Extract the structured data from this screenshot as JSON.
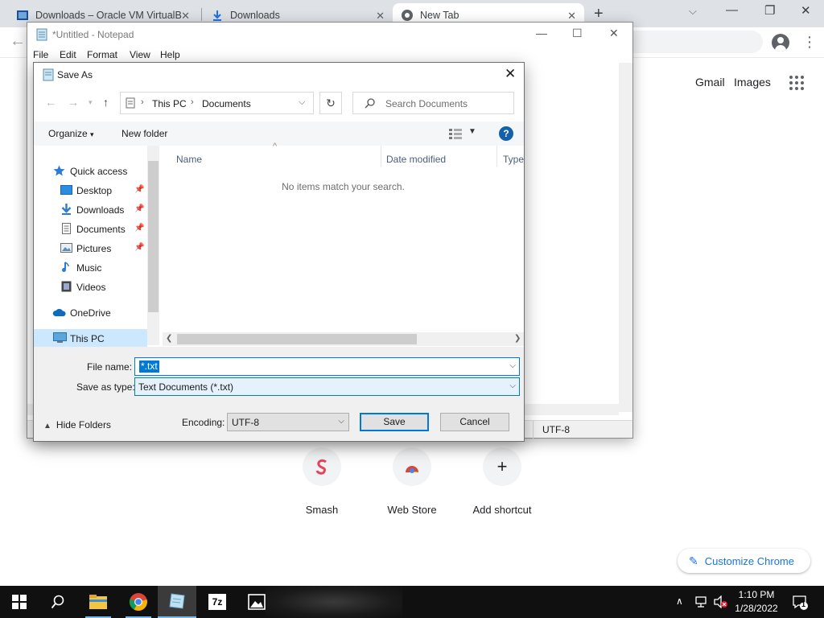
{
  "chrome": {
    "tabs": [
      {
        "label": "Downloads – Oracle VM VirtualB",
        "icon": "virtualbox-icon"
      },
      {
        "label": "Downloads",
        "icon": "download-icon"
      },
      {
        "label": "New Tab",
        "icon": "chrome-icon"
      }
    ],
    "header_links": {
      "gmail": "Gmail",
      "images": "Images"
    },
    "shortcuts": [
      {
        "label": "Smash",
        "icon": "smash-icon"
      },
      {
        "label": "Web Store",
        "icon": "webstore-icon"
      },
      {
        "label": "Add shortcut",
        "icon": "plus-icon"
      }
    ],
    "customize": "Customize Chrome"
  },
  "notepad": {
    "title": "*Untitled - Notepad",
    "menus": [
      "File",
      "Edit",
      "Format",
      "View",
      "Help"
    ],
    "status_encoding": "UTF-8"
  },
  "save_as": {
    "title": "Save As",
    "path": [
      "This PC",
      "Documents"
    ],
    "search_placeholder": "Search Documents",
    "organize": "Organize",
    "new_folder": "New folder",
    "help": "?",
    "nav_items": [
      {
        "label": "Quick access",
        "icon": "star-icon",
        "pinned": false
      },
      {
        "label": "Desktop",
        "icon": "desktop-icon",
        "pinned": true
      },
      {
        "label": "Downloads",
        "icon": "download-arrow-icon",
        "pinned": true
      },
      {
        "label": "Documents",
        "icon": "document-icon",
        "pinned": true
      },
      {
        "label": "Pictures",
        "icon": "pictures-icon",
        "pinned": true
      },
      {
        "label": "Music",
        "icon": "music-icon",
        "pinned": false
      },
      {
        "label": "Videos",
        "icon": "videos-icon",
        "pinned": false
      },
      {
        "label": "OneDrive",
        "icon": "cloud-icon",
        "pinned": false
      },
      {
        "label": "This PC",
        "icon": "computer-icon",
        "pinned": false,
        "selected": true
      }
    ],
    "columns": [
      "Name",
      "Date modified",
      "Type"
    ],
    "empty_message": "No items match your search.",
    "file_name_label": "File name:",
    "file_name_value": "*.txt",
    "save_as_type_label": "Save as type:",
    "save_as_type_value": "Text Documents (*.txt)",
    "hide_folders": "Hide Folders",
    "encoding_label": "Encoding:",
    "encoding_value": "UTF-8",
    "save": "Save",
    "cancel": "Cancel"
  },
  "taskbar": {
    "apps": [
      "start-icon",
      "search-icon",
      "file-explorer-icon",
      "chrome-icon",
      "notepad-icon",
      "7zip-icon",
      "photos-icon"
    ],
    "seven_zip_label": "7z",
    "time": "1:10 PM",
    "date": "1/28/2022",
    "notification_count": "1"
  },
  "colors": {
    "accent": "#0078d7",
    "selection": "#cce8ff",
    "taskbar": "#101010",
    "chrome_link": "#1a73e8",
    "help": "#1460aa"
  }
}
